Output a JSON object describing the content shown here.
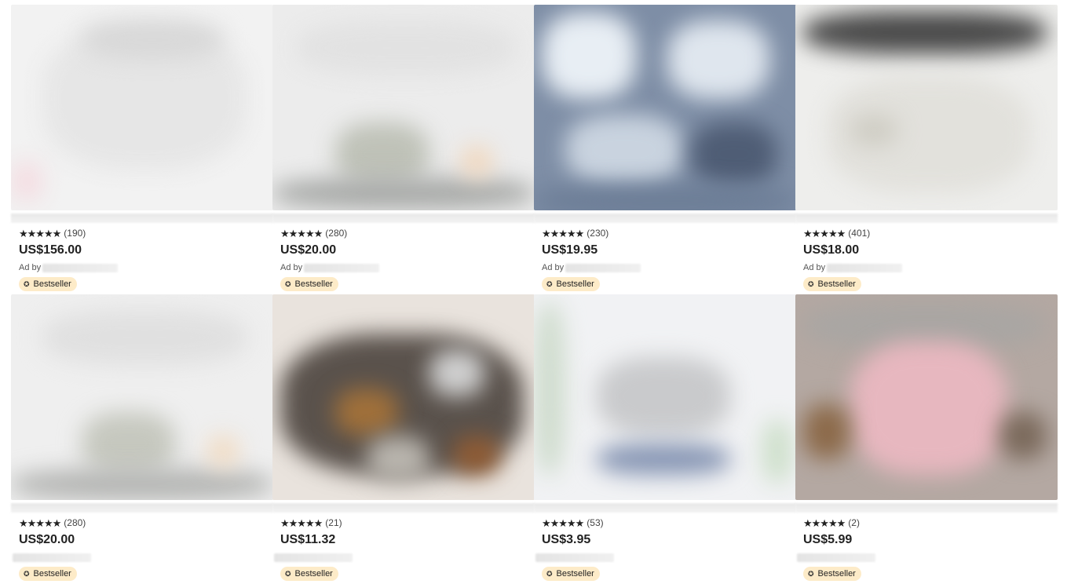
{
  "listings": [
    {
      "rating_count": "(190)",
      "price": "US$156.00",
      "ad_by": "Ad by",
      "badge": "Bestseller",
      "stars": 5
    },
    {
      "rating_count": "(280)",
      "price": "US$20.00",
      "ad_by": "Ad by",
      "badge": "Bestseller",
      "stars": 5
    },
    {
      "rating_count": "(230)",
      "price": "US$19.95",
      "ad_by": "Ad by",
      "badge": "Bestseller",
      "stars": 5
    },
    {
      "rating_count": "(401)",
      "price": "US$18.00",
      "ad_by": "Ad by",
      "badge": "Bestseller",
      "stars": 5
    },
    {
      "rating_count": "(280)",
      "price": "US$20.00",
      "ad_by": "",
      "badge": "Bestseller",
      "stars": 5
    },
    {
      "rating_count": "(21)",
      "price": "US$11.32",
      "ad_by": "",
      "badge": "Bestseller",
      "stars": 5
    },
    {
      "rating_count": "(53)",
      "price": "US$3.95",
      "ad_by": "",
      "badge": "Bestseller",
      "stars": 5
    },
    {
      "rating_count": "(2)",
      "price": "US$5.99",
      "ad_by": "",
      "badge": "Bestseller",
      "stars": 5
    }
  ],
  "colors": {
    "badge_bg": "#fdebc8",
    "text": "#222222",
    "muted": "#555555"
  },
  "icons": {
    "star": "star-icon",
    "badge": "award-icon"
  }
}
